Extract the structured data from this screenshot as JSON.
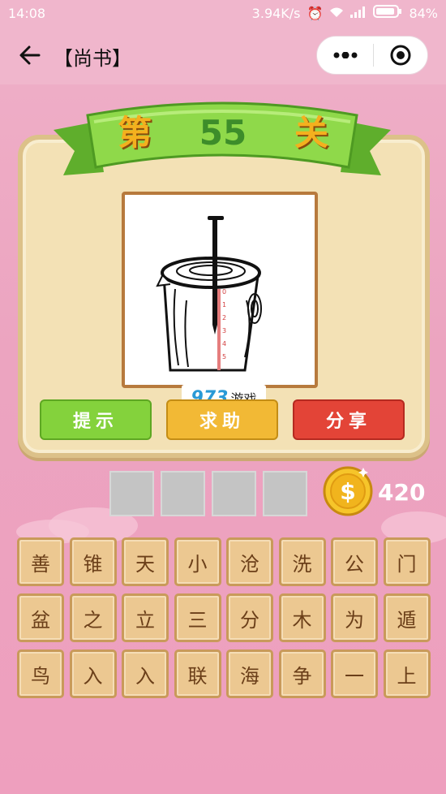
{
  "status": {
    "time": "14:08",
    "speed": "3.94K/s",
    "battery": "84%"
  },
  "nav": {
    "title": "【尚书】"
  },
  "level": {
    "prefix": "第",
    "number": "55",
    "suffix": "关"
  },
  "watermark": {
    "num": "973",
    "text": "游戏"
  },
  "buttons": {
    "hint": "提示",
    "help": "求助",
    "share": "分享"
  },
  "coins": {
    "count": "420"
  },
  "tiles": [
    "善",
    "锥",
    "天",
    "小",
    "沧",
    "洗",
    "公",
    "门",
    "盆",
    "之",
    "立",
    "三",
    "分",
    "木",
    "为",
    "遁",
    "鸟",
    "入",
    "入",
    "联",
    "海",
    "争",
    "一",
    "上"
  ],
  "colors": {
    "hint": "#84d23c",
    "help": "#f2b935",
    "share": "#e34437",
    "background": "#eca4c0"
  }
}
